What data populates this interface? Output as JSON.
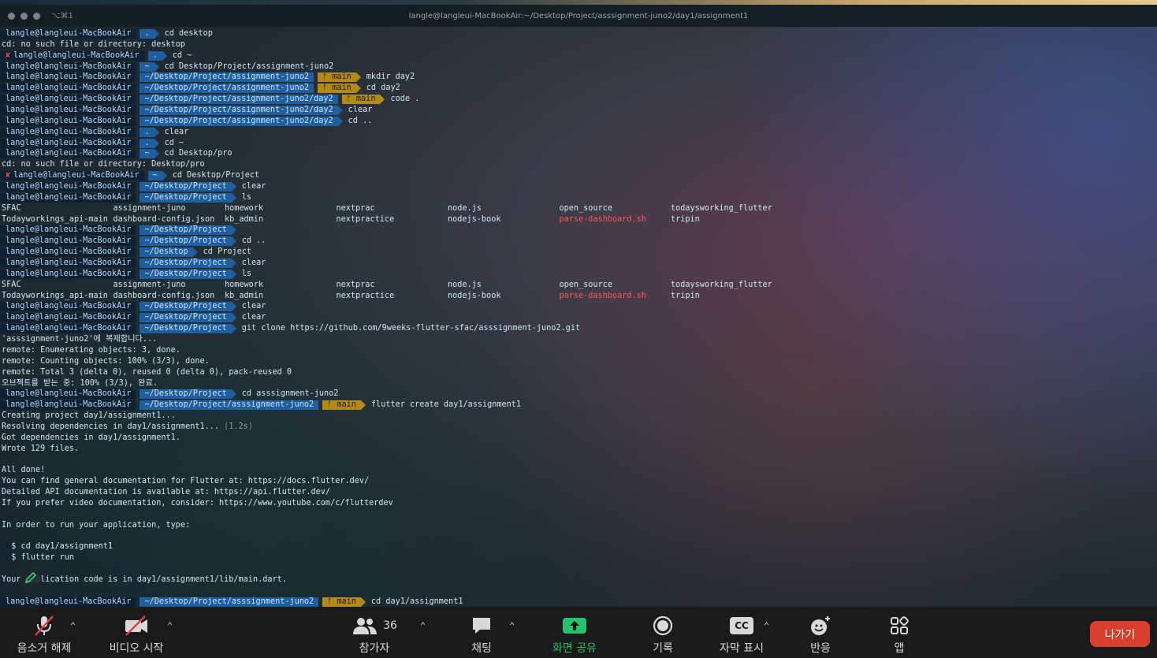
{
  "window": {
    "shortcut": "⌥⌘1",
    "title": "langle@langleui-MacBookAir:~/Desktop/Project/asssignment-juno2/day1/assignment1"
  },
  "prompt_user": "langle@langleui-MacBookAir",
  "lines": [
    {
      "kind": "prompt",
      "path": ".",
      "git": "",
      "cmd": "cd desktop"
    },
    {
      "kind": "text",
      "text": "cd: no such file or directory: desktop"
    },
    {
      "kind": "prompt",
      "err": "✘",
      "path": ".",
      "git": "",
      "cmd": "cd ~"
    },
    {
      "kind": "prompt",
      "path": "~",
      "git": "",
      "cmd": "cd Desktop/Project/assignment-juno2"
    },
    {
      "kind": "prompt",
      "path": "~/Desktop/Project/assignment-juno2",
      "git": "ᚠ main",
      "cmd": "mkdir day2"
    },
    {
      "kind": "prompt",
      "path": "~/Desktop/Project/assignment-juno2",
      "git": "ᚠ main",
      "cmd": "cd day2"
    },
    {
      "kind": "prompt",
      "path": "~/Desktop/Project/assignment-juno2/day2",
      "git": "ᚠ main",
      "cmd": "code ."
    },
    {
      "kind": "prompt",
      "path": "~/Desktop/Project/assignment-juno2/day2",
      "git": "",
      "cmd": "clear"
    },
    {
      "kind": "prompt",
      "path": "~/Desktop/Project/assignment-juno2/day2",
      "git": "",
      "cmd": "cd .."
    },
    {
      "kind": "prompt",
      "path": ".",
      "git": "",
      "cmd": "clear"
    },
    {
      "kind": "prompt",
      "path": ".",
      "git": "",
      "cmd": "cd ~"
    },
    {
      "kind": "prompt",
      "path": "~",
      "git": "",
      "cmd": "cd Desktop/pro"
    },
    {
      "kind": "text",
      "text": "cd: no such file or directory: Desktop/pro"
    },
    {
      "kind": "prompt",
      "err": "✘",
      "path": "~",
      "git": "",
      "cmd": "cd Desktop/Project"
    },
    {
      "kind": "prompt",
      "path": "~/Desktop/Project",
      "git": "",
      "cmd": "clear"
    },
    {
      "kind": "prompt",
      "path": "~/Desktop/Project",
      "git": "",
      "cmd": "ls"
    },
    {
      "kind": "ls",
      "cols": [
        "SFAC",
        "assignment-juno",
        "homework",
        "nextprac",
        "node.js",
        "open_source",
        "todaysworking_flutter"
      ]
    },
    {
      "kind": "ls",
      "cols": [
        "Todayworkings_api-main",
        "dashboard-config.json",
        "kb_admin",
        "nextpractice",
        "nodejs-book",
        "parse-dashboard.sh",
        "tripin"
      ],
      "red": 5
    },
    {
      "kind": "prompt",
      "path": "~/Desktop/Project",
      "git": "",
      "cmd": ""
    },
    {
      "kind": "prompt",
      "path": "~/Desktop/Project",
      "git": "",
      "cmd": "cd .."
    },
    {
      "kind": "prompt",
      "path": "~/Desktop",
      "git": "",
      "cmd": "cd Project"
    },
    {
      "kind": "prompt",
      "path": "~/Desktop/Project",
      "git": "",
      "cmd": "clear"
    },
    {
      "kind": "prompt",
      "path": "~/Desktop/Project",
      "git": "",
      "cmd": "ls"
    },
    {
      "kind": "ls",
      "cols": [
        "SFAC",
        "assignment-juno",
        "homework",
        "nextprac",
        "node.js",
        "open_source",
        "todaysworking_flutter"
      ]
    },
    {
      "kind": "ls",
      "cols": [
        "Todayworkings_api-main",
        "dashboard-config.json",
        "kb_admin",
        "nextpractice",
        "nodejs-book",
        "parse-dashboard.sh",
        "tripin"
      ],
      "red": 5
    },
    {
      "kind": "prompt",
      "path": "~/Desktop/Project",
      "git": "",
      "cmd": "clear"
    },
    {
      "kind": "prompt",
      "path": "~/Desktop/Project",
      "git": "",
      "cmd": "clear"
    },
    {
      "kind": "prompt",
      "path": "~/Desktop/Project",
      "git": "",
      "cmd": "git clone https://github.com/9weeks-flutter-sfac/asssignment-juno2.git"
    },
    {
      "kind": "text",
      "text": "'asssignment-juno2'에 복제합니다..."
    },
    {
      "kind": "text",
      "text": "remote: Enumerating objects: 3, done."
    },
    {
      "kind": "text",
      "text": "remote: Counting objects: 100% (3/3), done."
    },
    {
      "kind": "text",
      "text": "remote: Total 3 (delta 0), reused 0 (delta 0), pack-reused 0"
    },
    {
      "kind": "text",
      "text": "오브젝트를 받는 중: 100% (3/3), 완료."
    },
    {
      "kind": "prompt",
      "path": "~/Desktop/Project",
      "git": "",
      "cmd": "cd asssignment-juno2"
    },
    {
      "kind": "prompt",
      "path": "~/Desktop/Project/asssignment-juno2",
      "git": "ᚠ main",
      "cmd": "flutter create day1/assignment1"
    },
    {
      "kind": "text",
      "text": "Creating project day1/assignment1..."
    },
    {
      "kind": "text2",
      "text": "Resolving dependencies in day1/assignment1...",
      "dim": "(1.2s)"
    },
    {
      "kind": "text",
      "text": "Got dependencies in day1/assignment1."
    },
    {
      "kind": "text",
      "text": "Wrote 129 files."
    },
    {
      "kind": "text",
      "text": ""
    },
    {
      "kind": "text",
      "text": "All done!"
    },
    {
      "kind": "text",
      "text": "You can find general documentation for Flutter at: https://docs.flutter.dev/"
    },
    {
      "kind": "text",
      "text": "Detailed API documentation is available at: https://api.flutter.dev/"
    },
    {
      "kind": "text",
      "text": "If you prefer video documentation, consider: https://www.youtube.com/c/flutterdev"
    },
    {
      "kind": "text",
      "text": ""
    },
    {
      "kind": "text",
      "text": "In order to run your application, type:"
    },
    {
      "kind": "text",
      "text": ""
    },
    {
      "kind": "text",
      "text": "  $ cd day1/assignment1"
    },
    {
      "kind": "text",
      "text": "  $ flutter run"
    },
    {
      "kind": "text",
      "text": ""
    },
    {
      "kind": "text",
      "text": "Your application code is in day1/assignment1/lib/main.dart."
    },
    {
      "kind": "text",
      "text": ""
    },
    {
      "kind": "prompt",
      "path": "~/Desktop/Project/asssignment-juno2",
      "git": "ᚠ main",
      "cmd": "cd day1/assignment1"
    }
  ],
  "toolbar": {
    "mute_label": "음소거 해제",
    "video_label": "비디오 시작",
    "participants_label": "참가자",
    "participants_count": "36",
    "chat_label": "채팅",
    "share_label": "화면 공유",
    "record_label": "기록",
    "captions_label": "자막 표시",
    "captions_icon_text": "CC",
    "reactions_label": "반응",
    "apps_label": "앱",
    "leave_label": "나가기"
  },
  "colors": {
    "share_green": "#27c26b",
    "leave_red": "#d93f2f",
    "path_blue": "#1f5fa0",
    "git_gold": "#b48a16",
    "error_red": "#ff4a4a"
  }
}
